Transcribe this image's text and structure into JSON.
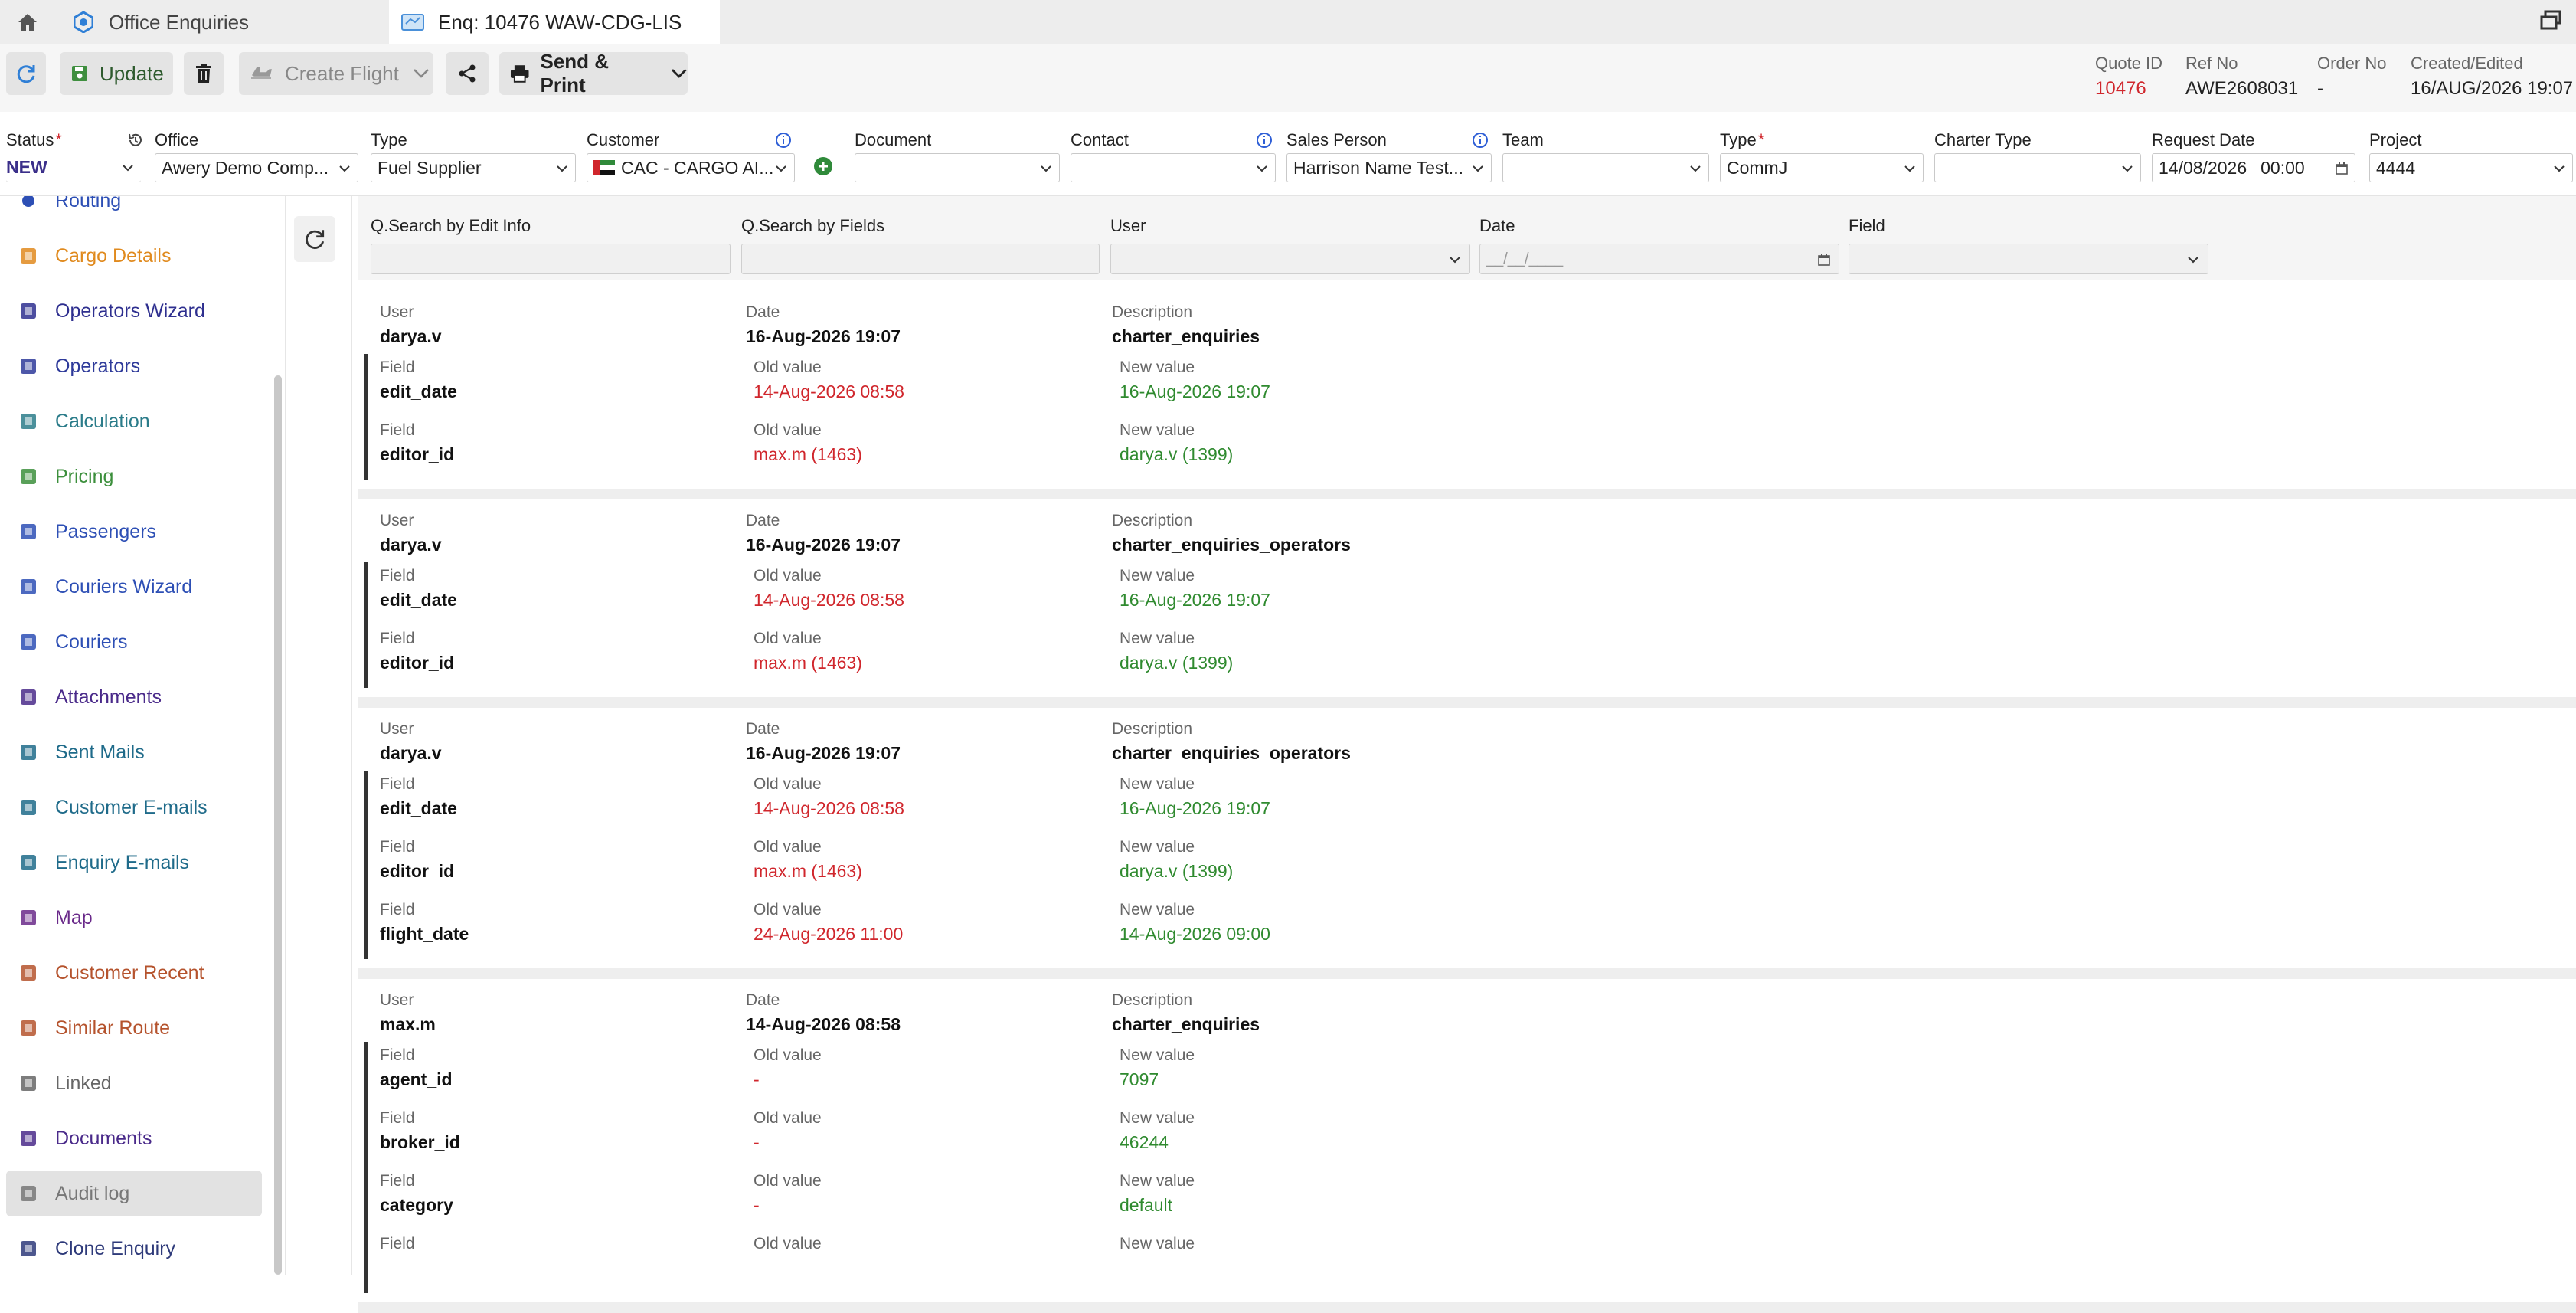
{
  "tabs": [
    {
      "label": "Office Enquiries"
    },
    {
      "label": "Enq: 10476 WAW-CDG-LIS"
    }
  ],
  "toolbar": {
    "update": "Update",
    "create_flight": "Create Flight",
    "send_print": "Send & Print"
  },
  "meta": {
    "quote_id_label": "Quote ID",
    "quote_id": "10476",
    "ref_no_label": "Ref No",
    "ref_no": "AWE2608031",
    "order_no_label": "Order No",
    "order_no": "-",
    "created_label": "Created/Edited",
    "created": "16/AUG/2026 19:07"
  },
  "form": {
    "status": {
      "label": "Status",
      "value": "NEW"
    },
    "office": {
      "label": "Office",
      "value": "Awery Demo Comp..."
    },
    "type": {
      "label": "Type",
      "value": "Fuel Supplier"
    },
    "customer": {
      "label": "Customer",
      "value": "CAC - CARGO AI..."
    },
    "document": {
      "label": "Document",
      "value": ""
    },
    "contact": {
      "label": "Contact",
      "value": ""
    },
    "sales_person": {
      "label": "Sales Person",
      "value": "Harrison Name Test..."
    },
    "team": {
      "label": "Team",
      "value": ""
    },
    "type2": {
      "label": "Type",
      "value": "CommJ"
    },
    "charter_type": {
      "label": "Charter Type",
      "value": ""
    },
    "request_date": {
      "label": "Request Date",
      "date": "14/08/2026",
      "time": "00:00"
    },
    "project": {
      "label": "Project",
      "value": "4444"
    }
  },
  "sidebar": {
    "partial_label": "Routing",
    "items": [
      {
        "label": "Cargo Details",
        "icon": "cargo-icon",
        "color": "#e08a1e"
      },
      {
        "label": "Operators Wizard",
        "icon": "operators-wizard-icon",
        "color": "#2e2f8f"
      },
      {
        "label": "Operators",
        "icon": "operators-icon",
        "color": "#2e3a9a"
      },
      {
        "label": "Calculation",
        "icon": "calculation-icon",
        "color": "#2b7c8a"
      },
      {
        "label": "Pricing",
        "icon": "pricing-icon",
        "color": "#3c8f3c"
      },
      {
        "label": "Passengers",
        "icon": "passengers-icon",
        "color": "#2d4fb5"
      },
      {
        "label": "Couriers Wizard",
        "icon": "couriers-wizard-icon",
        "color": "#2d4fb5"
      },
      {
        "label": "Couriers",
        "icon": "couriers-icon",
        "color": "#2d4fb5"
      },
      {
        "label": "Attachments",
        "icon": "attachment-icon",
        "color": "#4a2a8a"
      },
      {
        "label": "Sent Mails",
        "icon": "upload-icon",
        "color": "#1f6b8a"
      },
      {
        "label": "Customer E-mails",
        "icon": "mail-icon",
        "color": "#1f6b8a"
      },
      {
        "label": "Enquiry E-mails",
        "icon": "enquiry-mail-icon",
        "color": "#1f6b8a"
      },
      {
        "label": "Map",
        "icon": "map-icon",
        "color": "#6a2a8a"
      },
      {
        "label": "Customer Recent",
        "icon": "clock-icon",
        "color": "#b5532d"
      },
      {
        "label": "Similar Route",
        "icon": "route-icon",
        "color": "#b5532d"
      },
      {
        "label": "Linked",
        "icon": "link-icon",
        "color": "#666666"
      },
      {
        "label": "Documents",
        "icon": "documents-icon",
        "color": "#4a2a8a"
      },
      {
        "label": "Audit log",
        "icon": "audit-icon",
        "color": "#777777"
      },
      {
        "label": "Clone Enquiry",
        "icon": "clone-icon",
        "color": "#2e3a7a"
      }
    ]
  },
  "filters": {
    "q_edit": "Q.Search by Edit Info",
    "q_fields": "Q.Search by Fields",
    "user": "User",
    "date": "Date",
    "date_placeholder": "__/__/____",
    "field": "Field"
  },
  "labels": {
    "user": "User",
    "date": "Date",
    "description": "Description",
    "field": "Field",
    "old_value": "Old value",
    "new_value": "New value"
  },
  "entries": [
    {
      "user": "darya.v",
      "date": "16-Aug-2026 19:07",
      "description": "charter_enquiries",
      "changes": [
        {
          "field": "edit_date",
          "old": "14-Aug-2026 08:58",
          "new": "16-Aug-2026 19:07"
        },
        {
          "field": "editor_id",
          "old": "max.m (1463)",
          "new": "darya.v (1399)"
        }
      ]
    },
    {
      "user": "darya.v",
      "date": "16-Aug-2026 19:07",
      "description": "charter_enquiries_operators",
      "changes": [
        {
          "field": "edit_date",
          "old": "14-Aug-2026 08:58",
          "new": "16-Aug-2026 19:07"
        },
        {
          "field": "editor_id",
          "old": "max.m (1463)",
          "new": "darya.v (1399)"
        }
      ]
    },
    {
      "user": "darya.v",
      "date": "16-Aug-2026 19:07",
      "description": "charter_enquiries_operators",
      "changes": [
        {
          "field": "edit_date",
          "old": "14-Aug-2026 08:58",
          "new": "16-Aug-2026 19:07"
        },
        {
          "field": "editor_id",
          "old": "max.m (1463)",
          "new": "darya.v (1399)"
        },
        {
          "field": "flight_date",
          "old": "24-Aug-2026 11:00",
          "new": "14-Aug-2026 09:00"
        }
      ]
    },
    {
      "user": "max.m",
      "date": "14-Aug-2026 08:58",
      "description": "charter_enquiries",
      "changes": [
        {
          "field": "agent_id",
          "old": "-",
          "new": "7097"
        },
        {
          "field": "broker_id",
          "old": "-",
          "new": "46244"
        },
        {
          "field": "category",
          "old": "-",
          "new": "default"
        },
        {
          "field": "",
          "old": "",
          "new": ""
        }
      ]
    }
  ]
}
